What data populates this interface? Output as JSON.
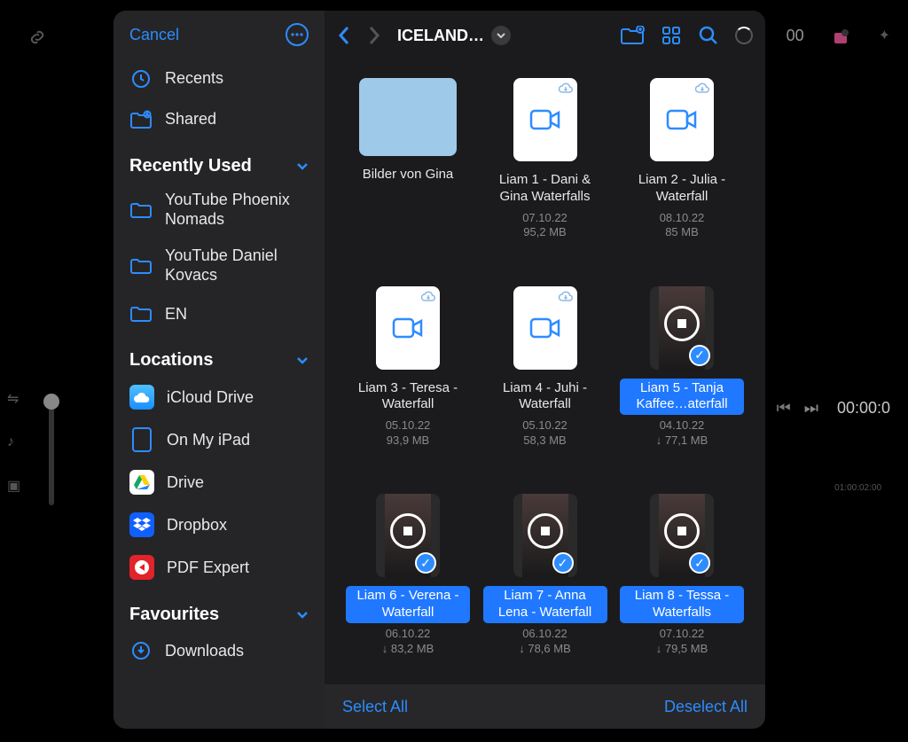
{
  "background": {
    "top_right_time": "00",
    "timecode_right": "00:00:0",
    "timeline_mark": "01:00:02:00"
  },
  "sidebar": {
    "cancel": "Cancel",
    "quick": [
      {
        "icon": "clock-icon",
        "label": "Recents"
      },
      {
        "icon": "shared-folder-icon",
        "label": "Shared"
      }
    ],
    "sections": {
      "recently_used": {
        "title": "Recently Used",
        "items": [
          {
            "label": "YouTube Phoenix Nomads"
          },
          {
            "label": "YouTube Daniel Kovacs"
          },
          {
            "label": "EN"
          }
        ]
      },
      "locations": {
        "title": "Locations",
        "items": [
          {
            "icon": "icloud",
            "label": "iCloud Drive"
          },
          {
            "icon": "ipad",
            "label": "On My iPad"
          },
          {
            "icon": "gdrive",
            "label": "Drive"
          },
          {
            "icon": "dropbox",
            "label": "Dropbox"
          },
          {
            "icon": "pdf",
            "label": "PDF Expert"
          }
        ]
      },
      "favourites": {
        "title": "Favourites",
        "items": [
          {
            "icon": "download-circle",
            "label": "Downloads"
          }
        ]
      }
    }
  },
  "topbar": {
    "title": "ICELAND…"
  },
  "files": [
    {
      "type": "folder",
      "name": "Bilder von Gina",
      "date": "",
      "size": "",
      "selected": false,
      "downloaded": false
    },
    {
      "type": "video-doc",
      "name": "Liam 1 - Dani & Gina Waterfalls",
      "date": "07.10.22",
      "size": "95,2 MB",
      "selected": false,
      "downloaded": false
    },
    {
      "type": "video-doc",
      "name": "Liam 2 - Julia - Waterfall",
      "date": "08.10.22",
      "size": "85 MB",
      "selected": false,
      "downloaded": false
    },
    {
      "type": "video-doc",
      "name": "Liam 3 - Teresa - Waterfall",
      "date": "05.10.22",
      "size": "93,9 MB",
      "selected": false,
      "downloaded": false
    },
    {
      "type": "video-doc",
      "name": "Liam 4 - Juhi - Waterfall",
      "date": "05.10.22",
      "size": "58,3 MB",
      "selected": false,
      "downloaded": false
    },
    {
      "type": "video-thumb",
      "name": "Liam 5 - Tanja Kaffee…aterfall",
      "date": "04.10.22",
      "size": "77,1 MB",
      "selected": true,
      "downloaded": true
    },
    {
      "type": "video-thumb",
      "name": "Liam 6 - Verena - Waterfall",
      "date": "06.10.22",
      "size": "83,2 MB",
      "selected": true,
      "downloaded": true
    },
    {
      "type": "video-thumb",
      "name": "Liam 7 - Anna Lena - Waterfall",
      "date": "06.10.22",
      "size": "78,6 MB",
      "selected": true,
      "downloaded": true
    },
    {
      "type": "video-thumb",
      "name": "Liam 8 - Tessa - Waterfalls",
      "date": "07.10.22",
      "size": "79,5 MB",
      "selected": true,
      "downloaded": true
    }
  ],
  "bottombar": {
    "select_all": "Select All",
    "deselect_all": "Deselect All"
  }
}
